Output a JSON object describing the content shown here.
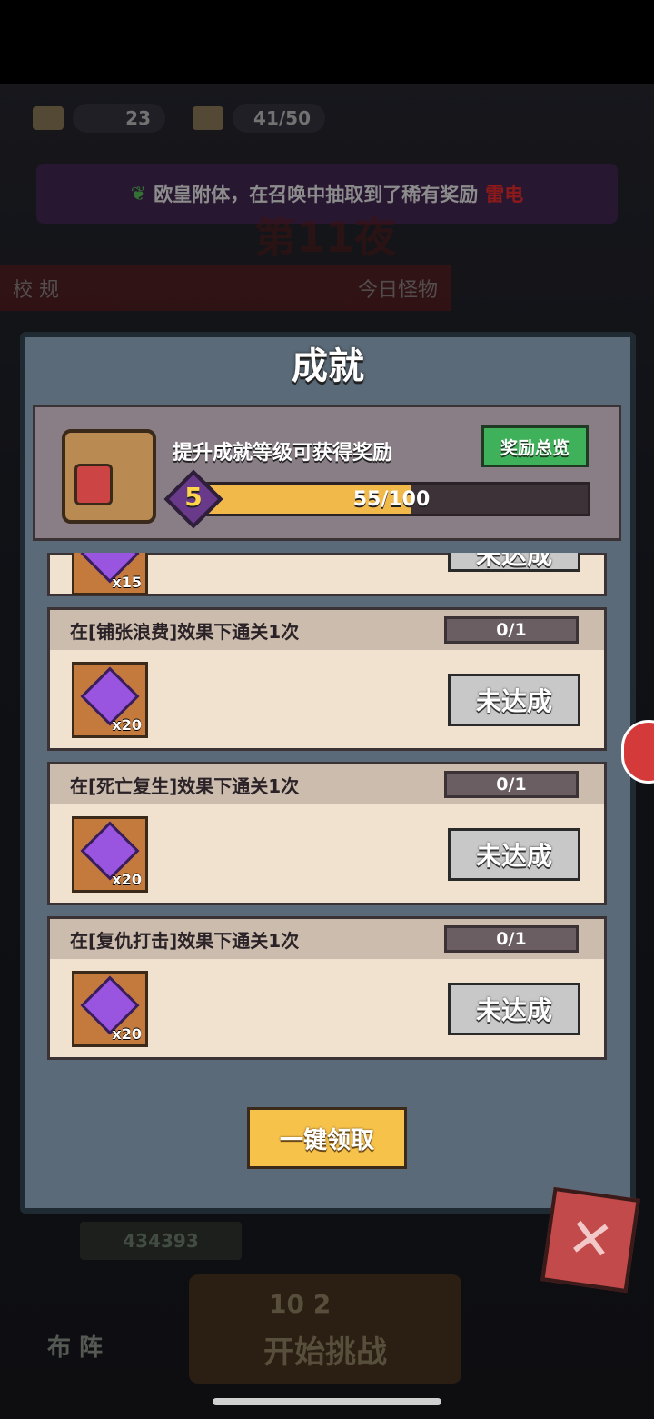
{
  "topbar": {
    "tickets": "23",
    "stamina": "41/50"
  },
  "banner": {
    "text": "欧皇附体，在召唤中抽取到了稀有奖励",
    "highlight": "雷电"
  },
  "background": {
    "night": "第11夜",
    "rules_label": "校 规",
    "monster_label": "今日怪物"
  },
  "panel": {
    "title": "成就",
    "subtitle": "提升成就等级可获得奖励",
    "overview_btn": "奖励总览",
    "level": "5",
    "progress_text": "55/100",
    "progress_value": 0.55
  },
  "items": [
    {
      "qty": "x15",
      "status": "未达成"
    },
    {
      "title": "在[铺张浪费]效果下通关1次",
      "progress": "0/1",
      "qty": "x20",
      "status": "未达成"
    },
    {
      "title": "在[死亡复生]效果下通关1次",
      "progress": "0/1",
      "qty": "x20",
      "status": "未达成"
    },
    {
      "title": "在[复仇打击]效果下通关1次",
      "progress": "0/1",
      "qty": "x20",
      "status": "未达成"
    }
  ],
  "claim_all": "一键领取",
  "bottom": {
    "power": "434393",
    "formation": "布 阵",
    "start_cost1": "10",
    "start_cost2": "2",
    "start_label": "开始挑战"
  }
}
